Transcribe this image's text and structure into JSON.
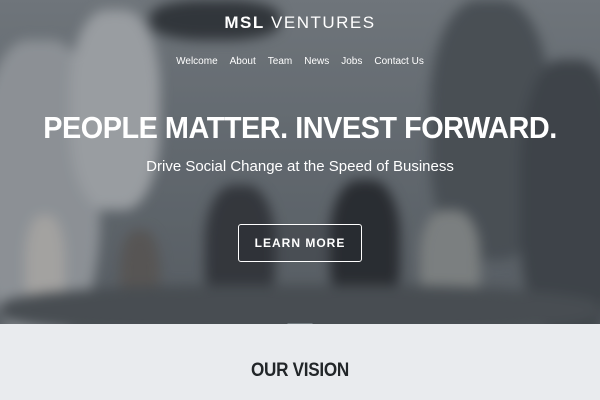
{
  "brand": {
    "part1": "MSL",
    "part2": "VENTURES"
  },
  "nav": {
    "items": [
      {
        "label": "Welcome"
      },
      {
        "label": "About"
      },
      {
        "label": "Team"
      },
      {
        "label": "News"
      },
      {
        "label": "Jobs"
      },
      {
        "label": "Contact Us"
      }
    ]
  },
  "hero": {
    "headline": "PEOPLE MATTER. INVEST FORWARD.",
    "subheadline": "Drive Social Change at the Speed of Business",
    "cta_label": "LEARN MORE"
  },
  "vision": {
    "title": "OUR VISION"
  },
  "colors": {
    "text_light": "#ffffff",
    "section_bg": "#e9ebee",
    "section_title": "#222629"
  }
}
